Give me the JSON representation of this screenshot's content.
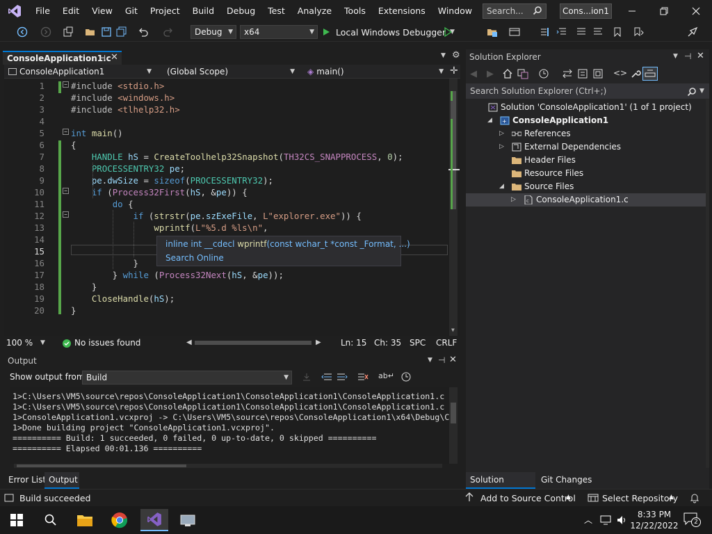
{
  "menu": [
    "File",
    "Edit",
    "View",
    "Git",
    "Project",
    "Build",
    "Debug",
    "Test",
    "Analyze",
    "Tools",
    "Extensions",
    "Window",
    "Help"
  ],
  "search": {
    "placeholder": "Search..."
  },
  "solution_badge": "Cons...ion1",
  "toolbar": {
    "config": "Debug",
    "platform": "x64",
    "run_label": "Local Windows Debugger"
  },
  "editor": {
    "tab_title": "ConsoleApplication1.c",
    "nav_project": "ConsoleApplication1",
    "nav_scope": "(Global Scope)",
    "nav_member": "main()",
    "lines": [
      {
        "n": "1",
        "html": "<span class='pp'>#include</span> <span class='st'>&lt;stdio.h&gt;</span>"
      },
      {
        "n": "2",
        "html": "<span class='pp'>#include</span> <span class='st'>&lt;windows.h&gt;</span>"
      },
      {
        "n": "3",
        "html": "<span class='pp'>#include</span> <span class='st'>&lt;tlhelp32.h&gt;</span>"
      },
      {
        "n": "4",
        "html": ""
      },
      {
        "n": "5",
        "html": "<span class='kw'>int</span> <span class='fn'>main</span>()"
      },
      {
        "n": "6",
        "html": "{"
      },
      {
        "n": "7",
        "html": "    <span class='ty'>HANDLE</span> <span class='vr'>hS</span> = <span class='fn'>CreateToolhelp32Snapshot</span>(<span class='mc'>TH32CS_SNAPPROCESS</span>, <span class='ct'>0</span>);"
      },
      {
        "n": "8",
        "html": "    <span class='ty'>PROCESSENTRY32</span> <span class='vr'>pe</span>;"
      },
      {
        "n": "9",
        "html": "    <span class='vr'>pe</span>.<span class='vr'>dwSize</span> = <span class='kw'>sizeof</span>(<span class='ty'>PROCESSENTRY32</span>);"
      },
      {
        "n": "10",
        "html": "    <span class='kw'>if</span> (<span class='mc'>Process32First</span>(<span class='vr'>hS</span>, &amp;<span class='vr'>pe</span>)) {"
      },
      {
        "n": "11",
        "html": "        <span class='kw'>do</span> {"
      },
      {
        "n": "12",
        "html": "            <span class='kw'>if</span> (<span class='fn'>strstr</span>(<span class='vr'>pe</span>.<span class='vr'>szExeFile</span>, <span class='st'>L\"explorer.exe\"</span>)) {"
      },
      {
        "n": "13",
        "html": "                <span class='fn'>wprintf</span>(<span class='st'>L\"%5.d %ls\\n\"</span>,"
      },
      {
        "n": "14",
        "html": ""
      },
      {
        "n": "15",
        "html": ""
      },
      {
        "n": "16",
        "html": "            }"
      },
      {
        "n": "17",
        "html": "        } <span class='kw'>while</span> (<span class='mc'>Process32Next</span>(<span class='vr'>hS</span>, &amp;<span class='vr'>pe</span>));"
      },
      {
        "n": "18",
        "html": "    }"
      },
      {
        "n": "19",
        "html": "    <span class='fn'>CloseHandle</span>(<span class='vr'>hS</span>);"
      },
      {
        "n": "20",
        "html": "}"
      }
    ],
    "tooltip_signature_prefix": "inline int __cdecl ",
    "tooltip_fn": "wprintf",
    "tooltip_params": "(const wchar_t *const _Format, ...)",
    "tooltip_link": "Search Online",
    "zoom": "100 %",
    "issues": "No issues found",
    "ln": "Ln: 15",
    "ch": "Ch: 35",
    "spc": "SPC",
    "crlf": "CRLF"
  },
  "solution_explorer": {
    "title": "Solution Explorer",
    "search_placeholder": "Search Solution Explorer (Ctrl+;)",
    "tree": [
      {
        "label": "Solution 'ConsoleApplication1' (1 of 1 project)",
        "indent": 0,
        "twisty": "",
        "icon": "solution",
        "bold": false,
        "sel": false
      },
      {
        "label": "ConsoleApplication1",
        "indent": 1,
        "twisty": "open",
        "icon": "project",
        "bold": true,
        "sel": false
      },
      {
        "label": "References",
        "indent": 2,
        "twisty": "closed",
        "icon": "references",
        "bold": false,
        "sel": false
      },
      {
        "label": "External Dependencies",
        "indent": 2,
        "twisty": "closed",
        "icon": "ext-deps",
        "bold": false,
        "sel": false
      },
      {
        "label": "Header Files",
        "indent": 2,
        "twisty": "",
        "icon": "folder",
        "bold": false,
        "sel": false
      },
      {
        "label": "Resource Files",
        "indent": 2,
        "twisty": "",
        "icon": "folder",
        "bold": false,
        "sel": false
      },
      {
        "label": "Source Files",
        "indent": 2,
        "twisty": "open",
        "icon": "folder",
        "bold": false,
        "sel": false
      },
      {
        "label": "ConsoleApplication1.c",
        "indent": 3,
        "twisty": "closed",
        "icon": "c-file",
        "bold": false,
        "sel": true
      }
    ],
    "tab_active": "Solution Explorer",
    "tab_other": "Git Changes"
  },
  "output": {
    "title": "Output",
    "source_label": "Show output from:",
    "source_value": "Build",
    "lines": [
      "1>C:\\Users\\VM5\\source\\repos\\ConsoleApplication1\\ConsoleApplication1\\ConsoleApplication1.c",
      "1>C:\\Users\\VM5\\source\\repos\\ConsoleApplication1\\ConsoleApplication1\\ConsoleApplication1.c",
      "1>ConsoleApplication1.vcxproj -> C:\\Users\\VM5\\source\\repos\\ConsoleApplication1\\x64\\Debug\\C",
      "1>Done building project \"ConsoleApplication1.vcxproj\".",
      "========== Build: 1 succeeded, 0 failed, 0 up-to-date, 0 skipped ==========",
      "========== Elapsed 00:01.136 =========="
    ],
    "tab_errors": "Error List",
    "tab_output": "Output"
  },
  "statusbar": {
    "build_status": "Build succeeded",
    "add_source_control": "Add to Source Control",
    "select_repo": "Select Repository",
    "notifications": "2"
  },
  "taskbar": {
    "time": "8:33 PM",
    "date": "12/22/2022",
    "notif_count": "2"
  },
  "colors": {
    "accent": "#0078d4",
    "vs_purple": "#8661c5",
    "run_green": "#3fb950",
    "change_bar": "#57a64a"
  }
}
